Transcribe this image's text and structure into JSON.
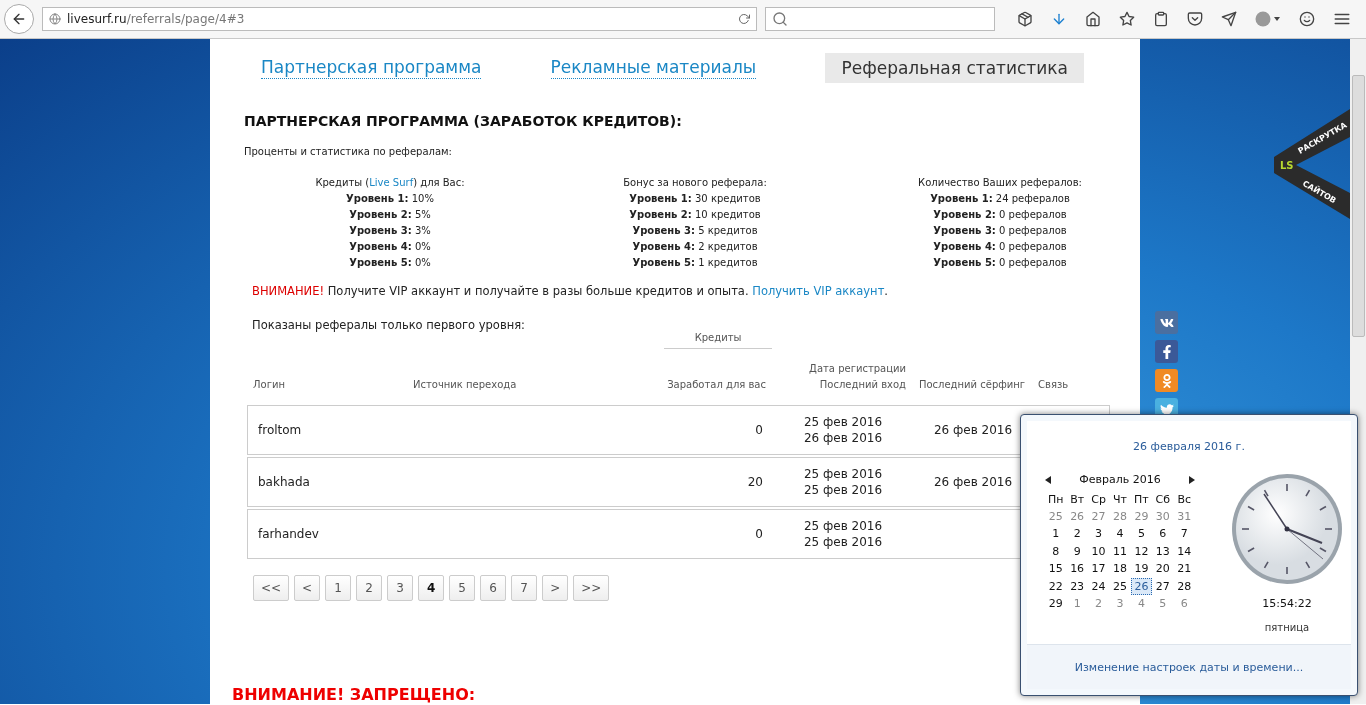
{
  "browser": {
    "url_host": "livesurf.ru",
    "url_path": "/referrals/page/4#3"
  },
  "tabs": [
    {
      "label": "Партнерская программа",
      "selected": false
    },
    {
      "label": "Рекламные материалы",
      "selected": false
    },
    {
      "label": "Реферальная статистика",
      "selected": true
    }
  ],
  "heading": "ПАРТНЕРСКАЯ ПРОГРАММА (ЗАРАБОТОК КРЕДИТОВ):",
  "subheading": "Проценты и статистика по рефералам:",
  "stats": [
    {
      "title_before": "Кредиты (",
      "title_link": "Live Surf",
      "title_after": ") для Вас:",
      "levels": [
        {
          "label": "Уровень 1:",
          "value": "10%"
        },
        {
          "label": "Уровень 2:",
          "value": "5%"
        },
        {
          "label": "Уровень 3:",
          "value": "3%"
        },
        {
          "label": "Уровень 4:",
          "value": "0%"
        },
        {
          "label": "Уровень 5:",
          "value": "0%"
        }
      ]
    },
    {
      "title_before": "Бонус за нового реферала:",
      "levels": [
        {
          "label": "Уровень 1:",
          "value": "30 кредитов"
        },
        {
          "label": "Уровень 2:",
          "value": "10 кредитов"
        },
        {
          "label": "Уровень 3:",
          "value": "5 кредитов"
        },
        {
          "label": "Уровень 4:",
          "value": "2 кредитов"
        },
        {
          "label": "Уровень 5:",
          "value": "1 кредитов"
        }
      ]
    },
    {
      "title_before": "Количество Ваших рефералов:",
      "levels": [
        {
          "label": "Уровень 1:",
          "value": "24 рефералов"
        },
        {
          "label": "Уровень 2:",
          "value": "0 рефералов"
        },
        {
          "label": "Уровень 3:",
          "value": "0 рефералов"
        },
        {
          "label": "Уровень 4:",
          "value": "0 рефералов"
        },
        {
          "label": "Уровень 5:",
          "value": "0 рефералов"
        }
      ]
    }
  ],
  "notice": {
    "alert": "ВНИМАНИЕ!",
    "text": " Получите VIP аккаунт и получайте в разы больше кредитов и опыта. ",
    "link": "Получить VIP аккаунт",
    "end": "."
  },
  "table_caption": "Показаны рефералы только первого уровня:",
  "table": {
    "group_header": "Кредиты",
    "columns": [
      "Логин",
      "Источник перехода",
      "Заработал для вас",
      "Дата регистрации\nПоследний вход",
      "Последний сёрфинг",
      "Связь"
    ],
    "rows": [
      {
        "login": "froltom",
        "earned": "0",
        "registered": "25 фев 2016",
        "last_login": "26 фев 2016",
        "last_surf": "26 фев 2016"
      },
      {
        "login": "bakhada",
        "earned": "20",
        "registered": "25 фев 2016",
        "last_login": "25 фев 2016",
        "last_surf": "26 фев 2016"
      },
      {
        "login": "farhandev",
        "earned": "0",
        "registered": "25 фев 2016",
        "last_login": "25 фев 2016"
      }
    ]
  },
  "pagination": [
    {
      "label": "<<",
      "selected": false
    },
    {
      "label": "<",
      "selected": false
    },
    {
      "label": "1",
      "selected": false
    },
    {
      "label": "2",
      "selected": false
    },
    {
      "label": "3",
      "selected": false
    },
    {
      "label": "4",
      "selected": true
    },
    {
      "label": "5",
      "selected": false
    },
    {
      "label": "6",
      "selected": false
    },
    {
      "label": "7",
      "selected": false
    },
    {
      "label": ">",
      "selected": false
    },
    {
      "label": ">>",
      "selected": false
    }
  ],
  "forbidden_heading": "ВНИМАНИЕ! ЗАПРЕЩЕНО:",
  "ribbon": {
    "logo": "LS",
    "line1": "РАСКРУТКА",
    "line2": "САЙТОВ"
  },
  "calendar": {
    "date_title": "26 февраля 2016 г.",
    "month": "Февраль 2016",
    "weekdays": [
      "Пн",
      "Вт",
      "Ср",
      "Чт",
      "Пт",
      "Сб",
      "Вс"
    ],
    "days": [
      {
        "label": "25",
        "kind": "other",
        "selected": false
      },
      {
        "label": "26",
        "kind": "other",
        "selected": false
      },
      {
        "label": "27",
        "kind": "other",
        "selected": false
      },
      {
        "label": "28",
        "kind": "other",
        "selected": false
      },
      {
        "label": "29",
        "kind": "other",
        "selected": false
      },
      {
        "label": "30",
        "kind": "other",
        "selected": false
      },
      {
        "label": "31",
        "kind": "other",
        "selected": false
      },
      {
        "label": "1",
        "kind": "current",
        "selected": false
      },
      {
        "label": "2",
        "kind": "current",
        "selected": false
      },
      {
        "label": "3",
        "kind": "current",
        "selected": false
      },
      {
        "label": "4",
        "kind": "current",
        "selected": false
      },
      {
        "label": "5",
        "kind": "current",
        "selected": false
      },
      {
        "label": "6",
        "kind": "current",
        "selected": false
      },
      {
        "label": "7",
        "kind": "current",
        "selected": false
      },
      {
        "label": "8",
        "kind": "current",
        "selected": false
      },
      {
        "label": "9",
        "kind": "current",
        "selected": false
      },
      {
        "label": "10",
        "kind": "current",
        "selected": false
      },
      {
        "label": "11",
        "kind": "current",
        "selected": false
      },
      {
        "label": "12",
        "kind": "current",
        "selected": false
      },
      {
        "label": "13",
        "kind": "current",
        "selected": false
      },
      {
        "label": "14",
        "kind": "current",
        "selected": false
      },
      {
        "label": "15",
        "kind": "current",
        "selected": false
      },
      {
        "label": "16",
        "kind": "current",
        "selected": false
      },
      {
        "label": "17",
        "kind": "current",
        "selected": false
      },
      {
        "label": "18",
        "kind": "current",
        "selected": false
      },
      {
        "label": "19",
        "kind": "current",
        "selected": false
      },
      {
        "label": "20",
        "kind": "current",
        "selected": false
      },
      {
        "label": "21",
        "kind": "current",
        "selected": false
      },
      {
        "label": "22",
        "kind": "current",
        "selected": false
      },
      {
        "label": "23",
        "kind": "current",
        "selected": false
      },
      {
        "label": "24",
        "kind": "current",
        "selected": false
      },
      {
        "label": "25",
        "kind": "current",
        "selected": false
      },
      {
        "label": "26",
        "kind": "current",
        "selected": true
      },
      {
        "label": "27",
        "kind": "current",
        "selected": false
      },
      {
        "label": "28",
        "kind": "current",
        "selected": false
      },
      {
        "label": "29",
        "kind": "current",
        "selected": false
      },
      {
        "label": "1",
        "kind": "other",
        "selected": false
      },
      {
        "label": "2",
        "kind": "other",
        "selected": false
      },
      {
        "label": "3",
        "kind": "other",
        "selected": false
      },
      {
        "label": "4",
        "kind": "other",
        "selected": false
      },
      {
        "label": "5",
        "kind": "other",
        "selected": false
      },
      {
        "label": "6",
        "kind": "other",
        "selected": false
      }
    ],
    "time": "15:54:22",
    "weekday": "пятница",
    "settings_link": "Изменение настроек даты и времени..."
  }
}
